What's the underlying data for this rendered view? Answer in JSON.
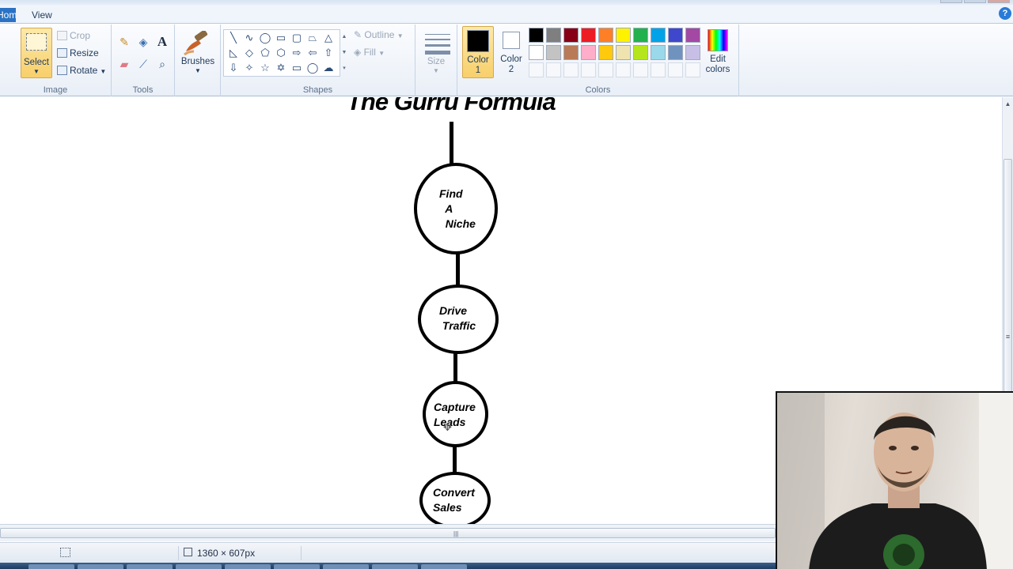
{
  "tabs": {
    "home": "Home",
    "view": "View"
  },
  "ribbon": {
    "image_group": {
      "label": "Image",
      "select": "Select",
      "crop": "Crop",
      "resize": "Resize",
      "rotate": "Rotate"
    },
    "tools_group": {
      "label": "Tools"
    },
    "brushes": "Brushes",
    "shapes_group": {
      "label": "Shapes",
      "outline": "Outline",
      "fill": "Fill"
    },
    "size": "Size",
    "colors_group": {
      "label": "Colors",
      "color1": "Color\n1",
      "color1_value": "#000000",
      "color2": "Color\n2",
      "color2_value": "#ffffff",
      "edit_colors": "Edit\ncolors",
      "palette_row1": [
        "#000000",
        "#7f7f7f",
        "#880015",
        "#ed1c24",
        "#ff7f27",
        "#fff200",
        "#22b14c",
        "#00a2e8",
        "#3f48cc",
        "#a349a4"
      ],
      "palette_row2": [
        "#ffffff",
        "#c3c3c3",
        "#b97a57",
        "#ffaec9",
        "#ffc90e",
        "#efe4b0",
        "#b5e61d",
        "#99d9ea",
        "#7092be",
        "#c8bfe7"
      ]
    }
  },
  "canvas": {
    "title": "The  Gurru Formula",
    "nodes": [
      {
        "text": "Find\n  A\n  Niche"
      },
      {
        "text": "Drive\n Traffic"
      },
      {
        "text": "Capture\nLeads"
      },
      {
        "text": "Convert\nSales"
      }
    ]
  },
  "status": {
    "dimensions": "1360 × 607px"
  }
}
